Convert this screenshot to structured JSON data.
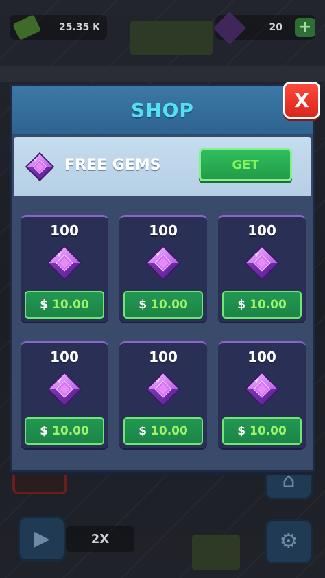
{
  "hud": {
    "cash": "25.35 K",
    "gems": "20",
    "plus": "+",
    "multiplier": "2X"
  },
  "shop": {
    "title": "SHOP",
    "close_label": "X",
    "free_gems": {
      "label": "FREE GEMS",
      "button": "GET"
    },
    "packs": [
      {
        "qty": "100",
        "currency": "$",
        "price": "10.00"
      },
      {
        "qty": "100",
        "currency": "$",
        "price": "10.00"
      },
      {
        "qty": "100",
        "currency": "$",
        "price": "10.00"
      },
      {
        "qty": "100",
        "currency": "$",
        "price": "10.00"
      },
      {
        "qty": "100",
        "currency": "$",
        "price": "10.00"
      },
      {
        "qty": "100",
        "currency": "$",
        "price": "10.00"
      }
    ]
  },
  "colors": {
    "title": "#55e0ef",
    "close": "#e8362b",
    "button_green": "#239c48",
    "gem": "#b76be8"
  },
  "icons": {
    "gem": "gem-icon",
    "close": "close-icon",
    "cash": "cash-icon",
    "home": "home-icon",
    "settings": "gear-icon",
    "video": "video-icon"
  }
}
